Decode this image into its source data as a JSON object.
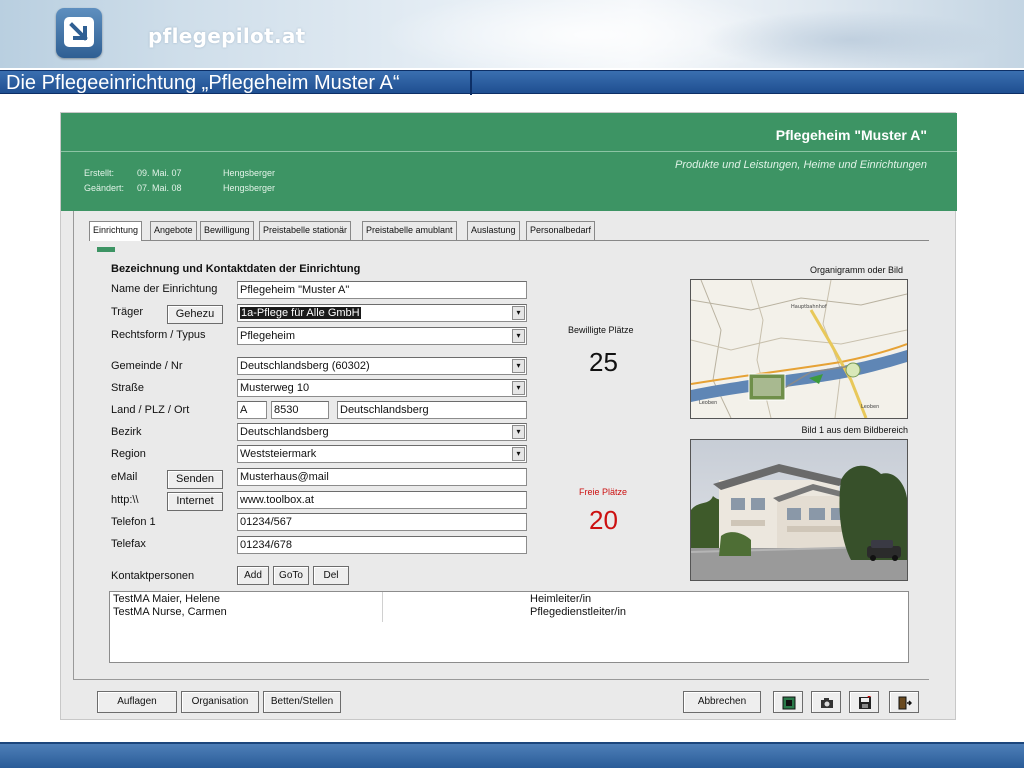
{
  "brand": {
    "name": "pflegepilot.at"
  },
  "page": {
    "title": "Die Pflegeeinrichtung „Pflegeheim Muster A“"
  },
  "form": {
    "heading": "Pflegeheim \"Muster A\"",
    "subtitle": "Produkte und Leistungen, Heime und Einrichtungen",
    "meta": {
      "created_label": "Erstellt:",
      "created_date": "09. Mai. 07",
      "created_by": "Hengsberger",
      "changed_label": "Geändert:",
      "changed_date": "07. Mai. 08",
      "changed_by": "Hengsberger"
    },
    "tabs": [
      {
        "label": "Einrichtung",
        "active": true
      },
      {
        "label": "Angebote",
        "active": false
      },
      {
        "label": "Bewilligung",
        "active": false
      },
      {
        "label": "Preistabelle stationär",
        "active": false
      },
      {
        "label": "Preistabelle amublant",
        "active": false
      },
      {
        "label": "Auslastung",
        "active": false
      },
      {
        "label": "Personalbedarf",
        "active": false
      }
    ],
    "section_title": "Bezeichnung und Kontaktdaten der Einrichtung",
    "labels": {
      "name": "Name der Einrichtung",
      "traeger": "Träger",
      "rechtsform": "Rechtsform / Typus",
      "gemeinde": "Gemeinde / Nr",
      "strasse": "Straße",
      "land": "Land  / PLZ  / Ort",
      "bezirk": "Bezirk",
      "region": "Region",
      "email": "eMail",
      "http": "http:\\\\",
      "telefon": "Telefon 1",
      "telefax": "Telefax",
      "kontakt": "Kontaktpersonen"
    },
    "values": {
      "name": "Pflegeheim \"Muster A\"",
      "traeger": "1a-Pflege für Alle GmbH",
      "rechtsform": "Pflegeheim",
      "gemeinde": "Deutschlandsberg (60302)",
      "strasse": "Musterweg 10",
      "land": "A",
      "plz": "8530",
      "ort": "Deutschlandsberg",
      "bezirk": "Deutschlandsberg",
      "region": "Weststeiermark",
      "email": "Musterhaus@mail",
      "http": "www.toolbox.at",
      "telefon": "01234/567",
      "telefax": "01234/678"
    },
    "buttons": {
      "gehezu": "Gehezu",
      "senden": "Senden",
      "internet": "Internet",
      "add": "Add",
      "goto": "GoTo",
      "del": "Del"
    },
    "stats": {
      "bewilligt_label": "Bewilligte Plätze",
      "bewilligt_value": "25",
      "frei_label": "Freie Plätze",
      "frei_value": "20"
    },
    "images": {
      "organigramm_caption": "Organigramm oder Bild",
      "bild_caption": "Bild 1 aus dem Bildbereich"
    },
    "contacts": [
      {
        "name": "TestMA Maier, Helene",
        "role": "Heimleiter/in"
      },
      {
        "name": "TestMA Nurse, Carmen",
        "role": "Pflegedienstleiter/in"
      }
    ],
    "bottom_buttons": {
      "auflagen": "Auflagen",
      "organisation": "Organisation",
      "betten": "Betten/Stellen",
      "abbrechen": "Abbrechen"
    }
  }
}
